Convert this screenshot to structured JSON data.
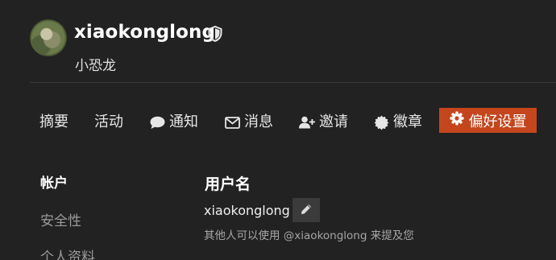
{
  "user": {
    "username": "xiaokonglong",
    "full_name": "小恐龙"
  },
  "nav": {
    "items": [
      {
        "label": "摘要"
      },
      {
        "label": "活动"
      },
      {
        "label": "通知",
        "icon": "comment-icon"
      },
      {
        "label": "消息",
        "icon": "envelope-icon"
      },
      {
        "label": "邀请",
        "icon": "user-plus-icon"
      },
      {
        "label": "徽章",
        "icon": "badge-icon"
      },
      {
        "label": "偏好设置",
        "icon": "gear-icon",
        "active": true
      }
    ]
  },
  "sidebar": {
    "items": [
      {
        "label": "帐户",
        "active": true
      },
      {
        "label": "安全性"
      },
      {
        "label": "个人资料"
      }
    ]
  },
  "account": {
    "section_title": "用户名",
    "username_value": "xiaokonglong",
    "username_hint": "其他人可以使用 @xiaokonglong 来提及您"
  },
  "colors": {
    "background": "#222222",
    "accent": "#c5461d"
  }
}
